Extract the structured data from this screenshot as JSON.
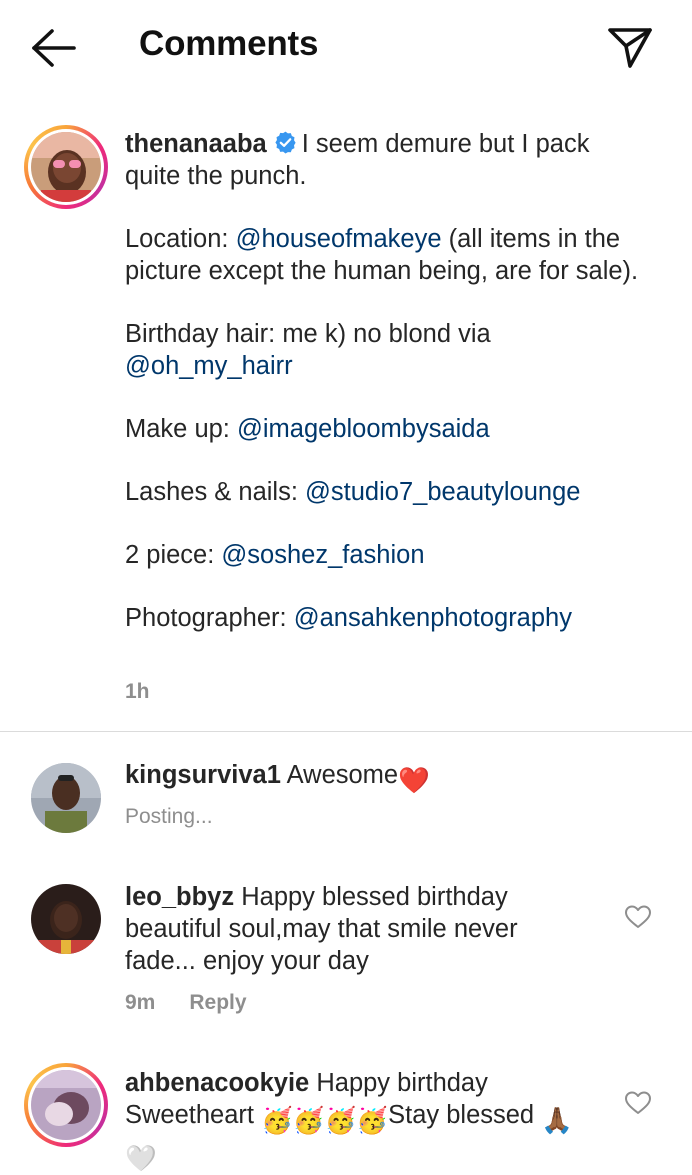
{
  "header": {
    "title": "Comments",
    "back_icon": "arrow-left-icon",
    "share_icon": "paper-plane-icon"
  },
  "caption": {
    "username": "thenanaaba",
    "verified_icon": "verified-badge-icon",
    "intro": "I seem demure but I pack quite the punch.",
    "location_label": "Location:",
    "location_mention": "@houseofmakeye",
    "location_note": "(all items in the picture except the human being, are for sale).",
    "hair_label": "Birthday hair: me k) no blond via",
    "hair_mention": "@oh_my_hairr",
    "makeup_label": "Make up:",
    "makeup_mention": "@imagebloombysaida",
    "lashes_label": "Lashes & nails:",
    "lashes_mention": "@studio7_beautylounge",
    "piece_label": "2 piece:",
    "piece_mention": "@soshez_fashion",
    "photo_label": "Photographer:",
    "photo_mention": "@ansahkenphotography",
    "time": "1h"
  },
  "comments": [
    {
      "username": "kingsurviva1",
      "text": "Awesome",
      "emoji": "❤️",
      "status": "Posting..."
    },
    {
      "username": "leo_bbyz",
      "text": "Happy blessed birthday beautiful soul,may that smile never fade... enjoy your day",
      "time": "9m",
      "reply": "Reply"
    },
    {
      "username": "ahbenacookyie",
      "text_start": "Happy birthday Sweetheart",
      "party_emojis": "🥳🥳🥳🥳",
      "text_end": "Stay blessed",
      "pray_emoji": "🙏🏾",
      "heart_emoji": "🤍"
    }
  ],
  "colors": {
    "mention": "#00376b",
    "secondary_text": "#8e8e8e",
    "verified": "#3897f0",
    "heart": "#ed2939",
    "divider": "#dbdbdb"
  }
}
